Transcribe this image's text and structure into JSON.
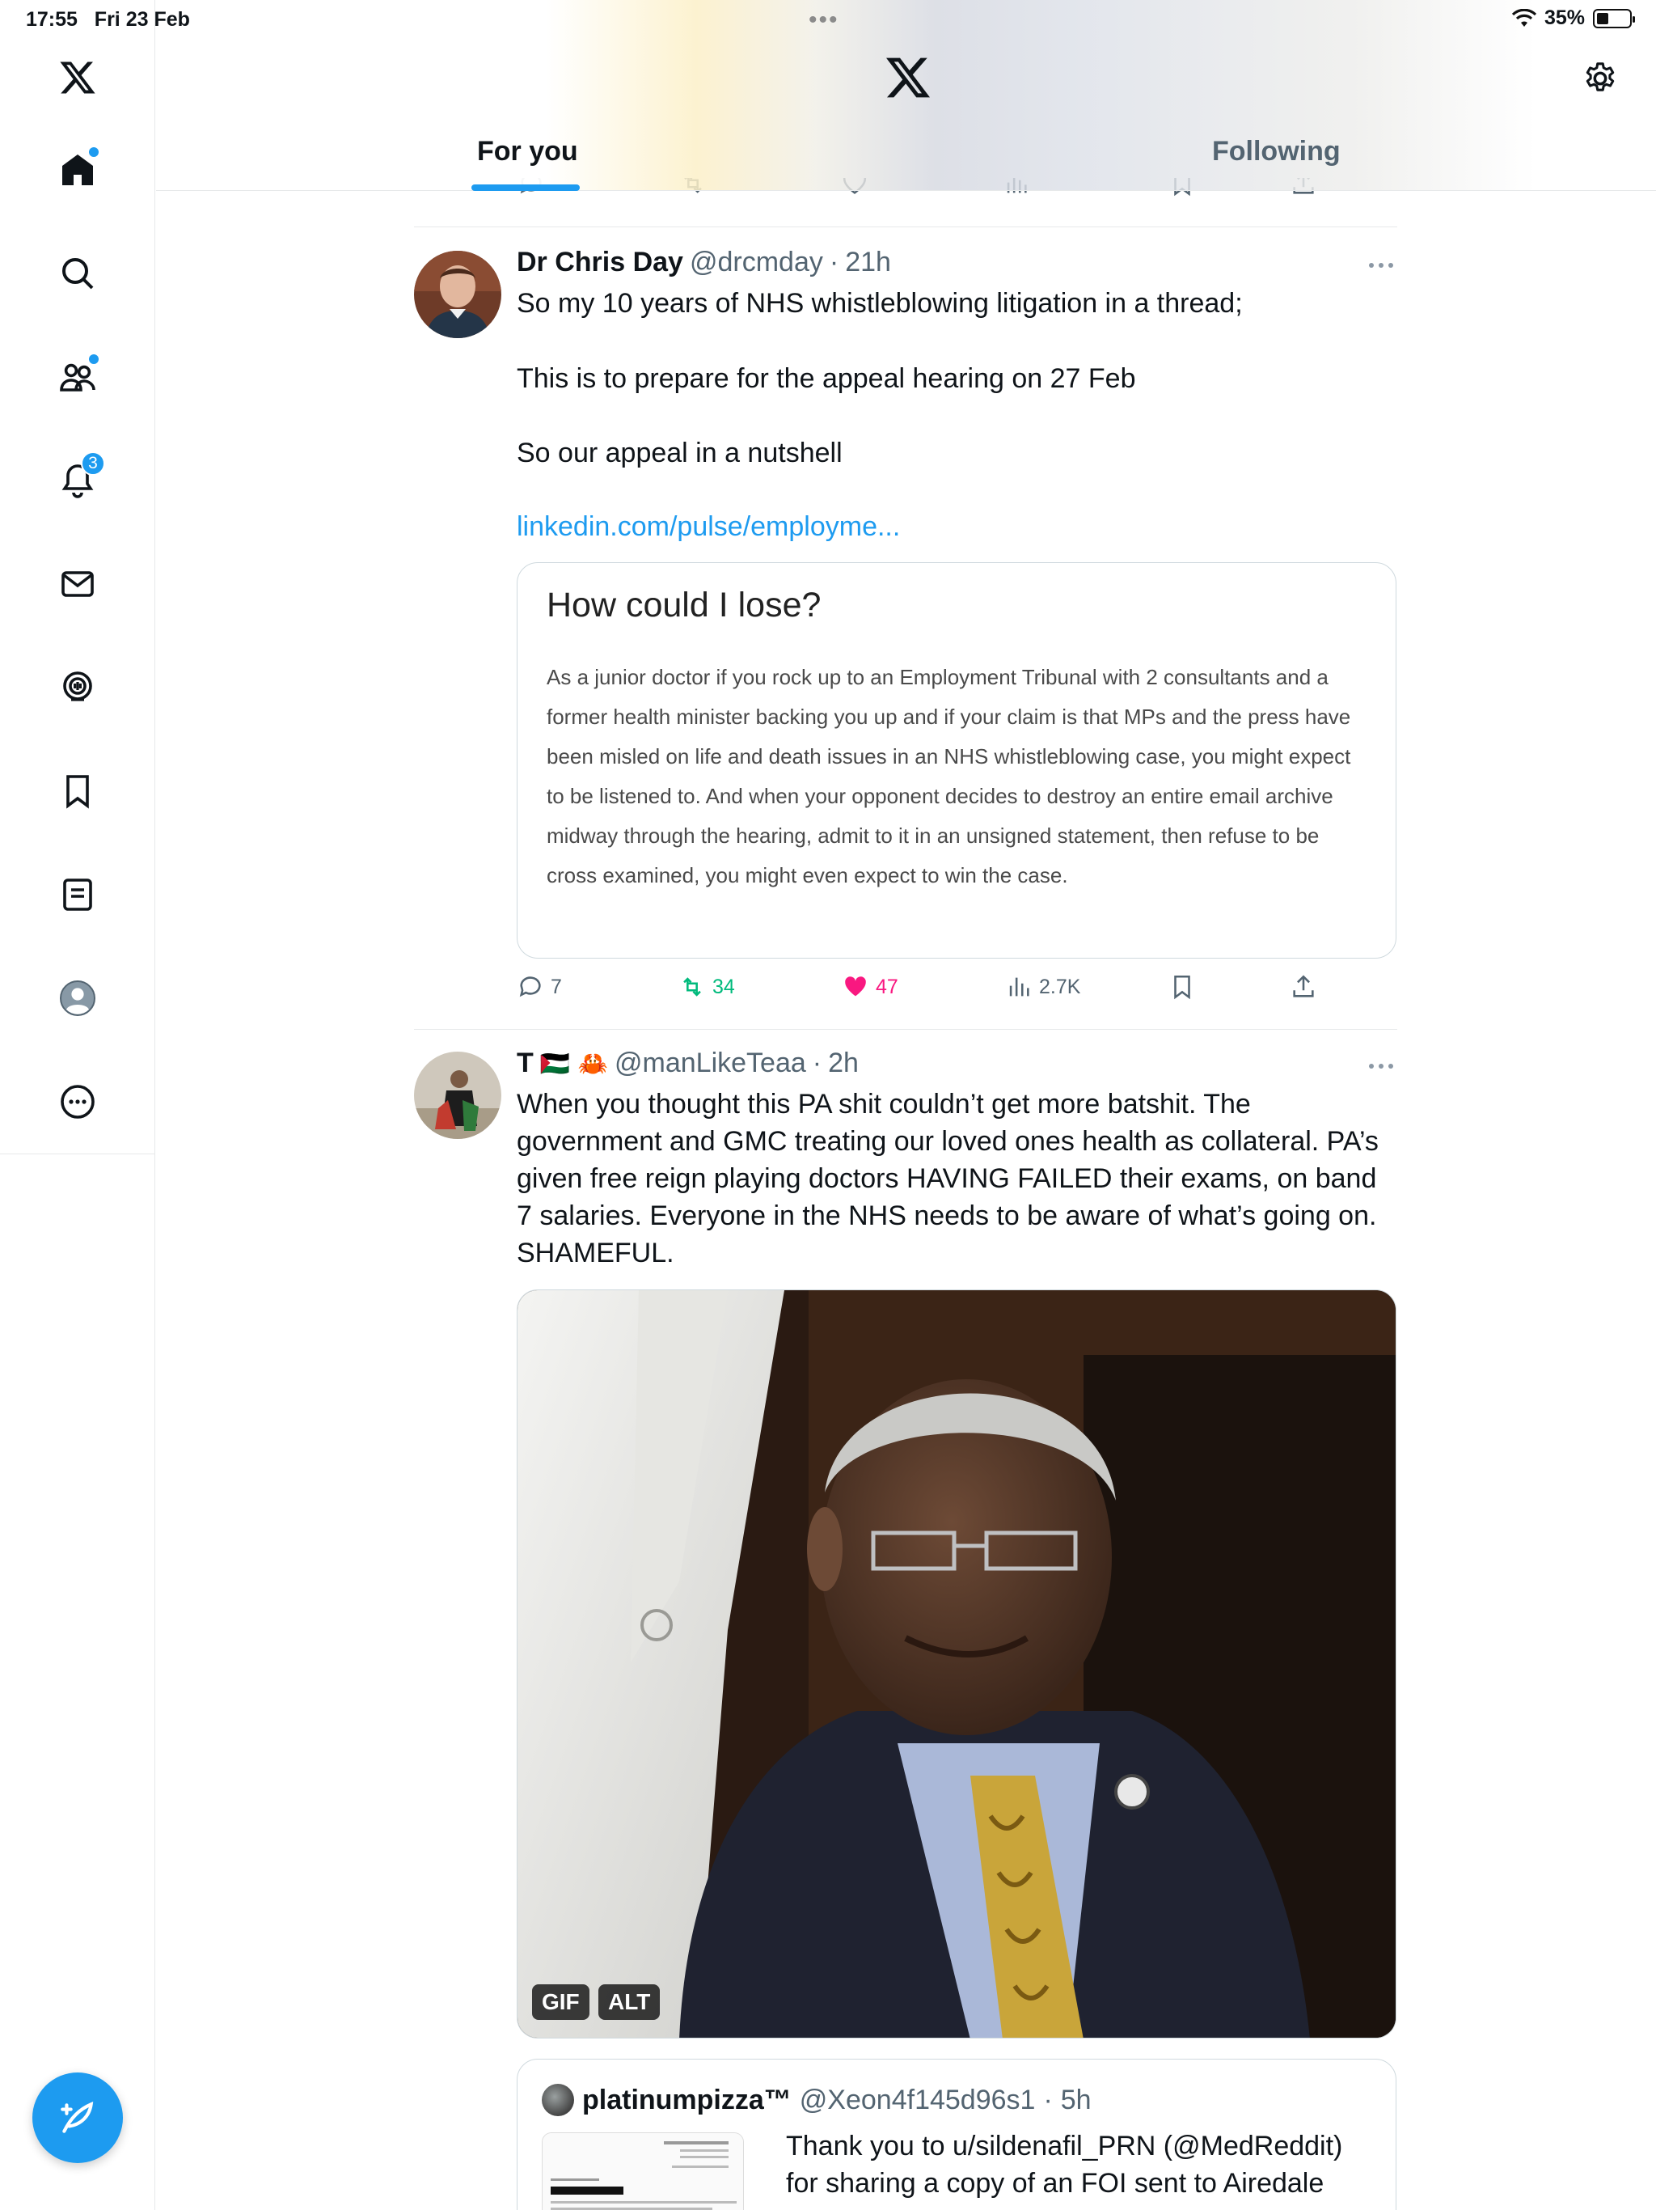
{
  "status_bar": {
    "time": "17:55",
    "date": "Fri 23 Feb",
    "battery": "35%",
    "battery_level": 0.35,
    "dots": "•••"
  },
  "sidebar": {
    "items": [
      {
        "name": "x-logo"
      },
      {
        "name": "home",
        "has_dot": true
      },
      {
        "name": "explore"
      },
      {
        "name": "communities",
        "has_dot": true
      },
      {
        "name": "notifications",
        "badge": "3"
      },
      {
        "name": "messages"
      },
      {
        "name": "spaces"
      },
      {
        "name": "bookmarks"
      },
      {
        "name": "lists"
      },
      {
        "name": "profile"
      },
      {
        "name": "more"
      }
    ],
    "notifications_badge": "3"
  },
  "header": {
    "tabs": [
      {
        "label": "For you",
        "active": true
      },
      {
        "label": "Following",
        "active": false
      }
    ]
  },
  "colors": {
    "accent": "#1d9bf0",
    "text_primary": "#0f1419",
    "text_secondary": "#536471",
    "retweet_green": "#00ba7c",
    "like_pink": "#f91880"
  },
  "tweets": [
    {
      "name": "Dr Chris Day",
      "handle": "@drcmday",
      "sep": "·",
      "time": "21h",
      "text_lines": [
        "So my 10 years of NHS whistleblowing litigation in a thread;",
        "This is to prepare for the appeal hearing on 27 Feb",
        "So our appeal in a nutshell"
      ],
      "link": "linkedin.com/pulse/employme...",
      "card": {
        "title": "How could I lose?",
        "body": "As a junior doctor if you rock up to an Employment Tribunal with 2 consultants and a former health minister backing you up and if your claim is that MPs and the press have been misled on life and death issues in an NHS whistleblowing case, you might expect to be listened to. And when your opponent decides to destroy an entire email archive midway through the hearing, admit to it in an unsigned statement, then refuse to be cross examined, you might even expect to win the case."
      },
      "replies": "7",
      "retweets": "34",
      "likes": "47",
      "views": "2.7K",
      "retweeted": true,
      "liked": true
    },
    {
      "name": "T",
      "name_emoji": "🇵🇸 🦀",
      "handle": "@manLikeTeaa",
      "sep": "·",
      "time": "2h",
      "text": "When you thought this PA shit couldn’t get more batshit. The government and GMC treating our loved ones health as collateral. PA’s given free reign playing doctors HAVING FAILED their exams, on band 7 salaries. Everyone in the NHS needs to be aware of what’s going on. SHAMEFUL.",
      "media": {
        "badge_gif": "GIF",
        "badge_alt": "ALT"
      },
      "quote": {
        "name": "platinumpizza™",
        "handle": "@Xeon4f145d96s1",
        "sep": "·",
        "time": "5h",
        "text": "Thank you to u/sildenafil_PRN (@MedReddit) for sharing a copy of an FOI sent to Airedale"
      }
    }
  ]
}
